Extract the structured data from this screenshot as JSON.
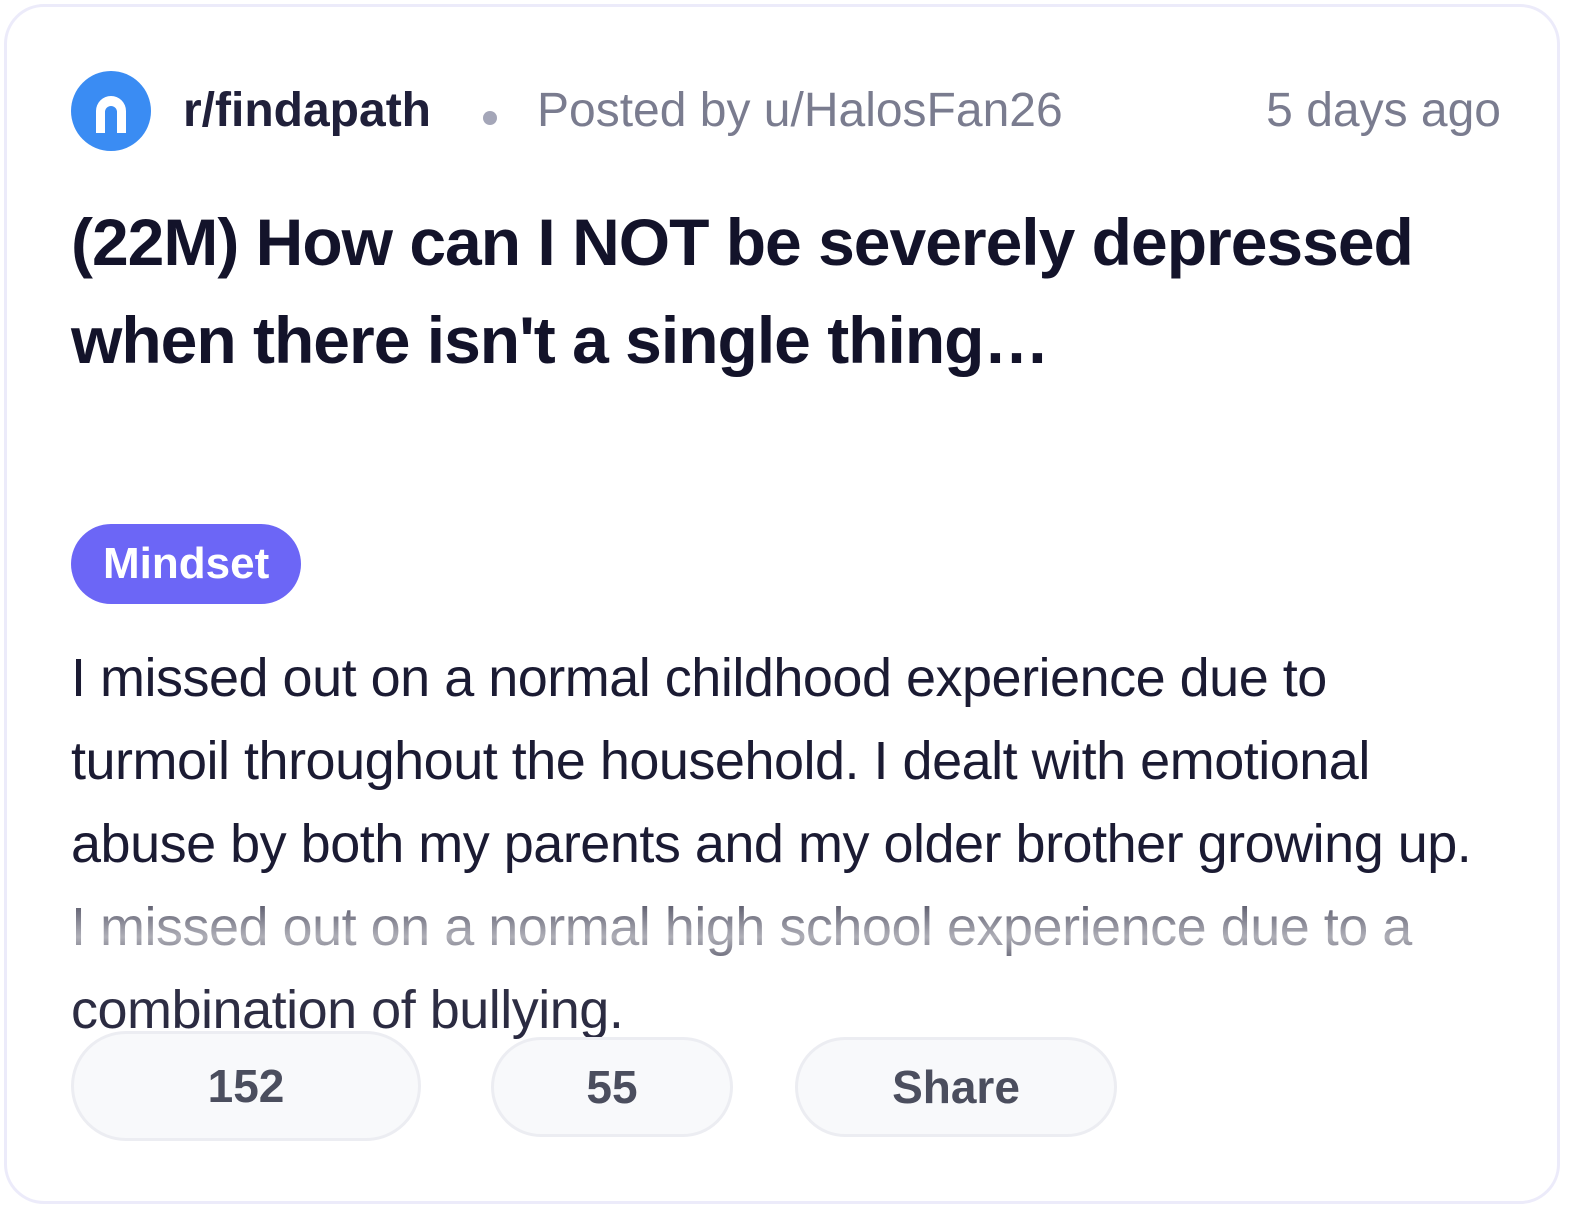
{
  "post": {
    "subreddit": "r/findapath",
    "posted_by": "Posted by u/HalosFan26",
    "time_ago": "5 days ago",
    "title": "(22M) How can I NOT be severely depressed when there isn't a single thing…",
    "flair": "Mindset",
    "body": "I missed out on a normal childhood experience due to turmoil throughout the household. I dealt with emotional abuse by both my parents and my older brother growing up. I missed out on a normal high school experience due to a combination of bullying."
  },
  "actions": {
    "votes": "152",
    "comments": "55",
    "share_label": "Share"
  },
  "colors": {
    "subreddit_logo": "#3a8cf3",
    "flair_bg": "#6c66f6",
    "card_border": "#ecebfa"
  }
}
